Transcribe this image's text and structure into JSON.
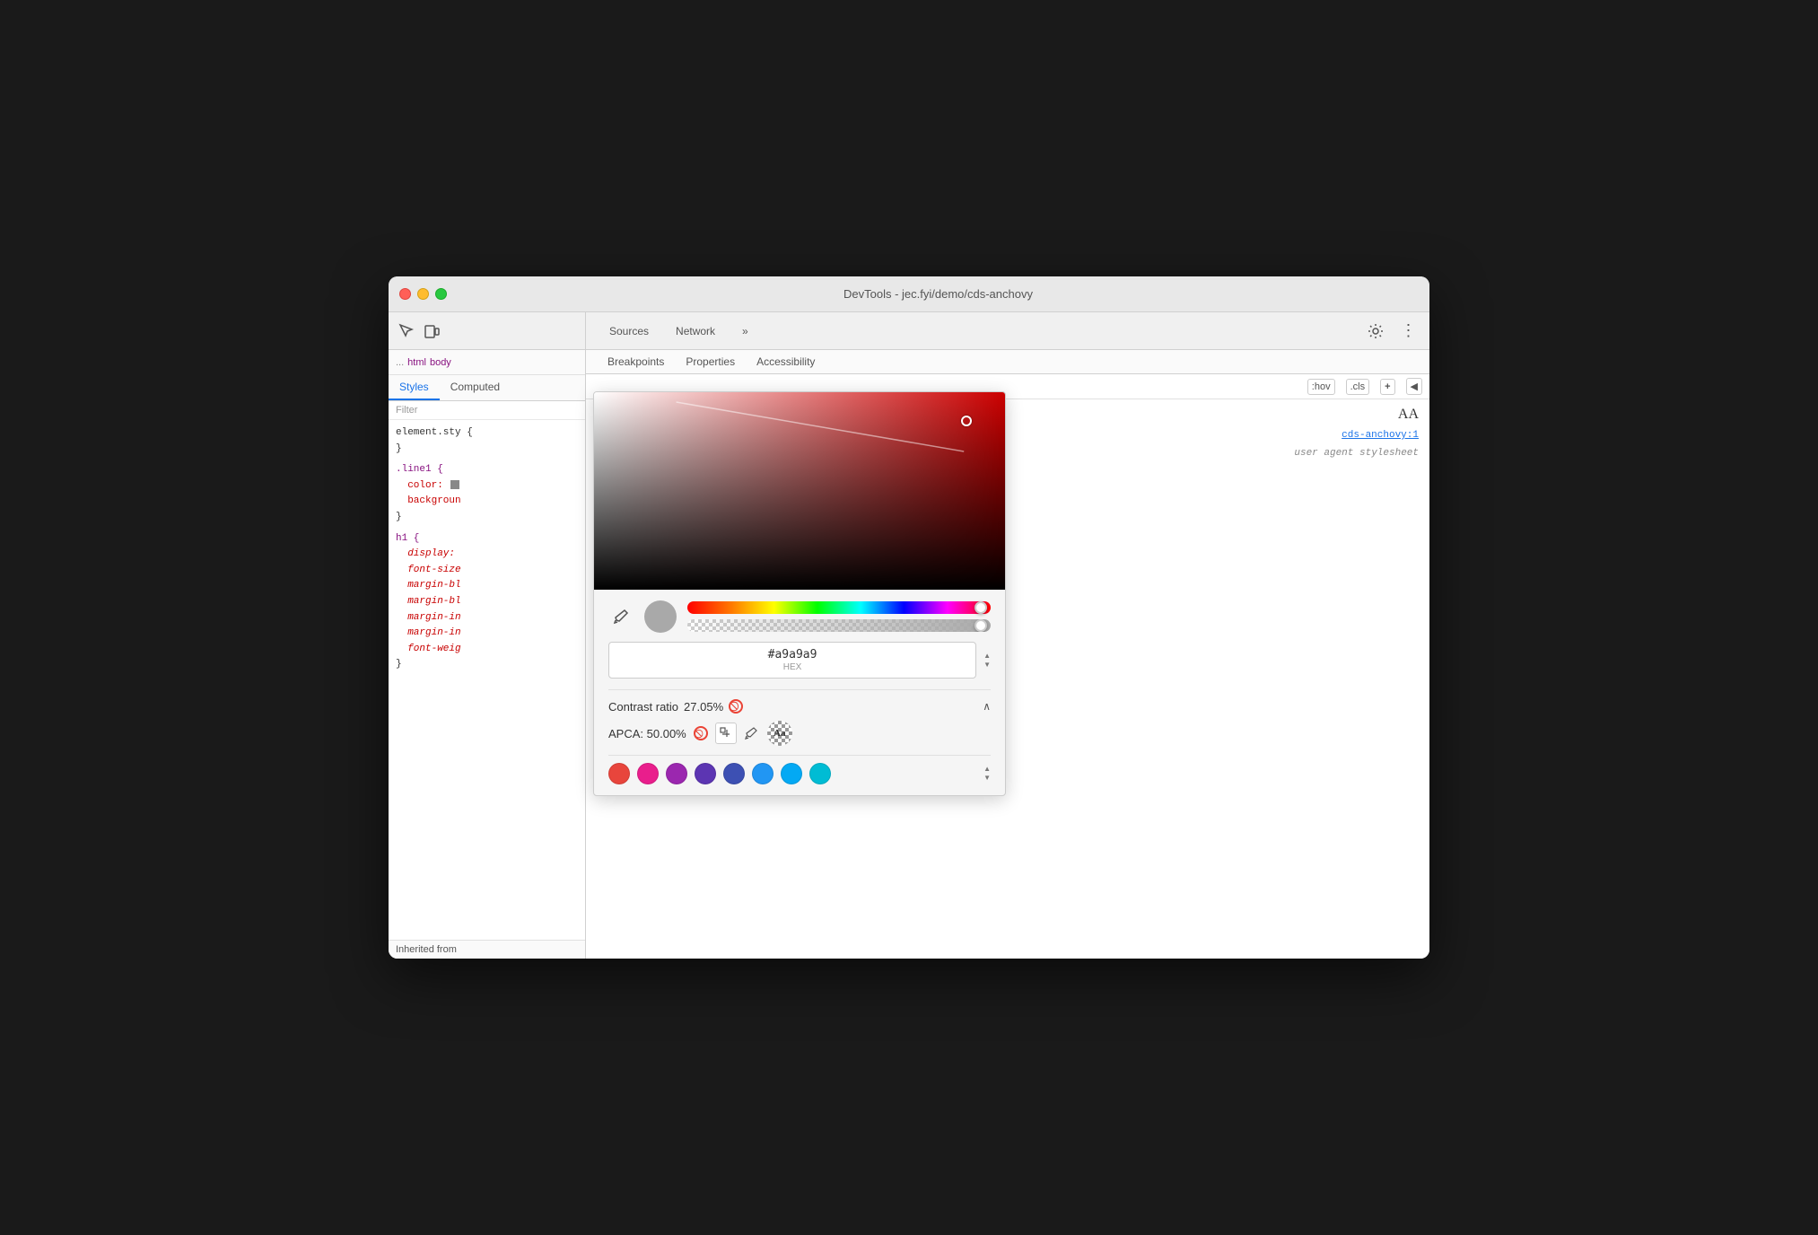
{
  "window": {
    "title": "DevTools - jec.fyi/demo/cds-anchovy"
  },
  "toolbar": {
    "inspector_icon": "⬚",
    "device_icon": "◫",
    "sources_tab": "Sources",
    "network_tab": "Network",
    "more_tabs_icon": "»",
    "settings_icon": "⚙",
    "more_icon": "⋮"
  },
  "dom_breadcrumb": {
    "dots": "...",
    "html_tag": "html",
    "body_tag": "body"
  },
  "left_panel": {
    "tabs": [
      "Styles",
      "Computed"
    ],
    "active_tab": "Styles",
    "filter_placeholder": "Filter",
    "css_rules": [
      {
        "selector": "element.style",
        "properties": [],
        "brace_open": "{",
        "brace_close": "}"
      },
      {
        "selector": ".line1",
        "properties": [
          {
            "name": "color",
            "value": ""
          },
          {
            "name": "background",
            "value": ""
          }
        ],
        "brace_open": "{",
        "brace_close": "}"
      },
      {
        "selector": "h1",
        "properties": [
          {
            "name": "display",
            "value": ""
          },
          {
            "name": "font-size",
            "value": ""
          },
          {
            "name": "margin-block-start",
            "value": ""
          },
          {
            "name": "margin-block-end",
            "value": ""
          },
          {
            "name": "margin-inline-start",
            "value": ""
          },
          {
            "name": "margin-inline-end",
            "value": ""
          },
          {
            "name": "font-weight",
            "value": ""
          }
        ],
        "brace_open": "{",
        "brace_close": "}"
      }
    ],
    "inherited_from": "Inherited from"
  },
  "right_panel": {
    "sub_tabs": [
      "Breakpoints",
      "Properties",
      "Accessibility"
    ],
    "active_sub_tab": "Breakpoints",
    "actions": {
      "hov_btn": ":hov",
      "cls_btn": ".cls",
      "add_btn": "+",
      "arrow_btn": "◀"
    },
    "font_size_icon": "AA",
    "source_link": "cds-anchovy:1",
    "user_agent_text": "user agent stylesheet"
  },
  "color_picker": {
    "hex_value": "#a9a9a9",
    "hex_label": "HEX",
    "contrast_label": "Contrast ratio",
    "contrast_value": "27.05%",
    "apca_label": "APCA:",
    "apca_value": "50.00%",
    "aa_text": "Aa",
    "gradient_color": "#cc0000",
    "preview_color": "#a9a9a9",
    "swatches": [
      {
        "color": "#e8453c",
        "label": "red-swatch"
      },
      {
        "color": "#e91e8c",
        "label": "pink-swatch"
      },
      {
        "color": "#9b27af",
        "label": "purple-swatch"
      },
      {
        "color": "#5c35b2",
        "label": "deep-purple-swatch"
      },
      {
        "color": "#3d50b3",
        "label": "indigo-swatch"
      },
      {
        "color": "#2196f3",
        "label": "blue-swatch"
      },
      {
        "color": "#03a9f4",
        "label": "light-blue-swatch"
      },
      {
        "color": "#00bcd4",
        "label": "cyan-swatch"
      }
    ]
  }
}
